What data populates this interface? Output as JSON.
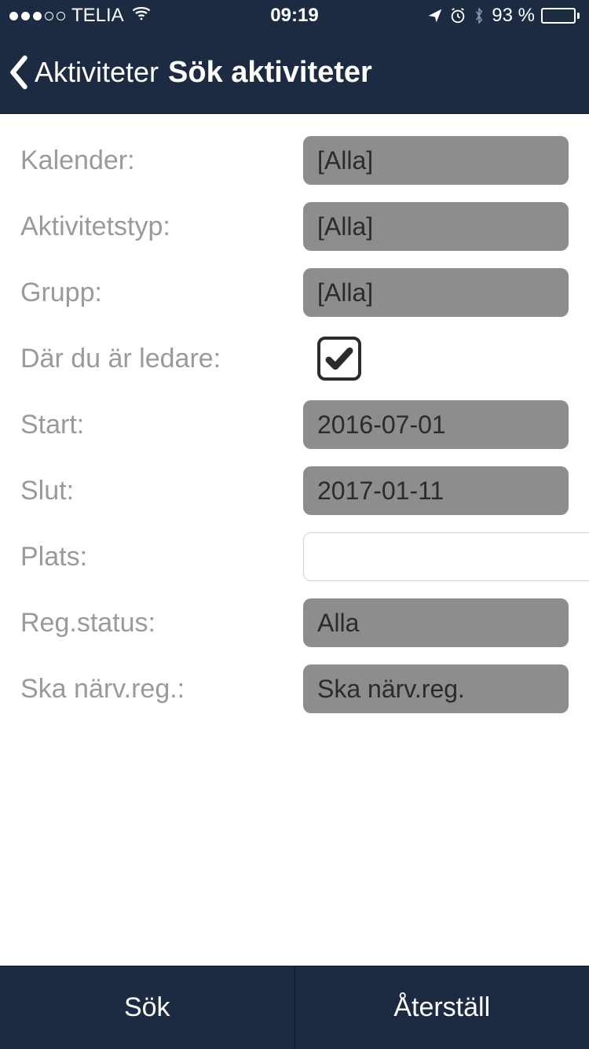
{
  "status_bar": {
    "carrier": "TELIA",
    "time": "09:19",
    "battery_pct": "93 %"
  },
  "nav": {
    "back_label": "Aktiviteter",
    "title": "Sök aktiviteter"
  },
  "form": {
    "kalender": {
      "label": "Kalender:",
      "value": "[Alla]"
    },
    "aktivitetstyp": {
      "label": "Aktivitetstyp:",
      "value": "[Alla]"
    },
    "grupp": {
      "label": "Grupp:",
      "value": "[Alla]"
    },
    "ledare": {
      "label": "Där du är ledare:",
      "checked": true
    },
    "start": {
      "label": "Start:",
      "value": "2016-07-01"
    },
    "slut": {
      "label": "Slut:",
      "value": "2017-01-11"
    },
    "plats": {
      "label": "Plats:",
      "value": ""
    },
    "regstatus": {
      "label": "Reg.status:",
      "value": "Alla"
    },
    "skanarv": {
      "label": "Ska närv.reg.:",
      "value": "Ska närv.reg."
    }
  },
  "footer": {
    "search": "Sök",
    "reset": "Återställ"
  }
}
